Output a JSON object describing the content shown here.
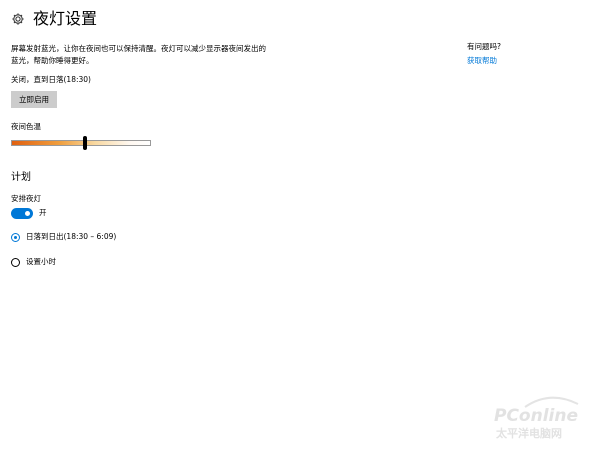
{
  "page": {
    "title": "夜灯设置",
    "icon": "gear-icon"
  },
  "description": "屏幕发射蓝光，让你在夜间也可以保持清醒。夜灯可以减少显示器夜间发出的蓝光，帮助你睡得更好。",
  "status": "关闭，直到日落(18:30)",
  "enable_button": "立即启用",
  "color_temp": {
    "label": "夜间色温",
    "level": 0.53
  },
  "schedule": {
    "section_title": "计划",
    "label": "安排夜灯",
    "toggle_state": "开",
    "toggle_on": true,
    "options": [
      {
        "label": "日落到日出(18:30 – 6:09)",
        "selected": true
      },
      {
        "label": "设置小时",
        "selected": false
      }
    ]
  },
  "help": {
    "title": "有问题吗?",
    "link": "获取帮助"
  },
  "watermark": {
    "brand": "PConline",
    "subtitle": "太平洋电脑网"
  },
  "colors": {
    "accent": "#0078d7",
    "button_bg": "#cccccc"
  }
}
